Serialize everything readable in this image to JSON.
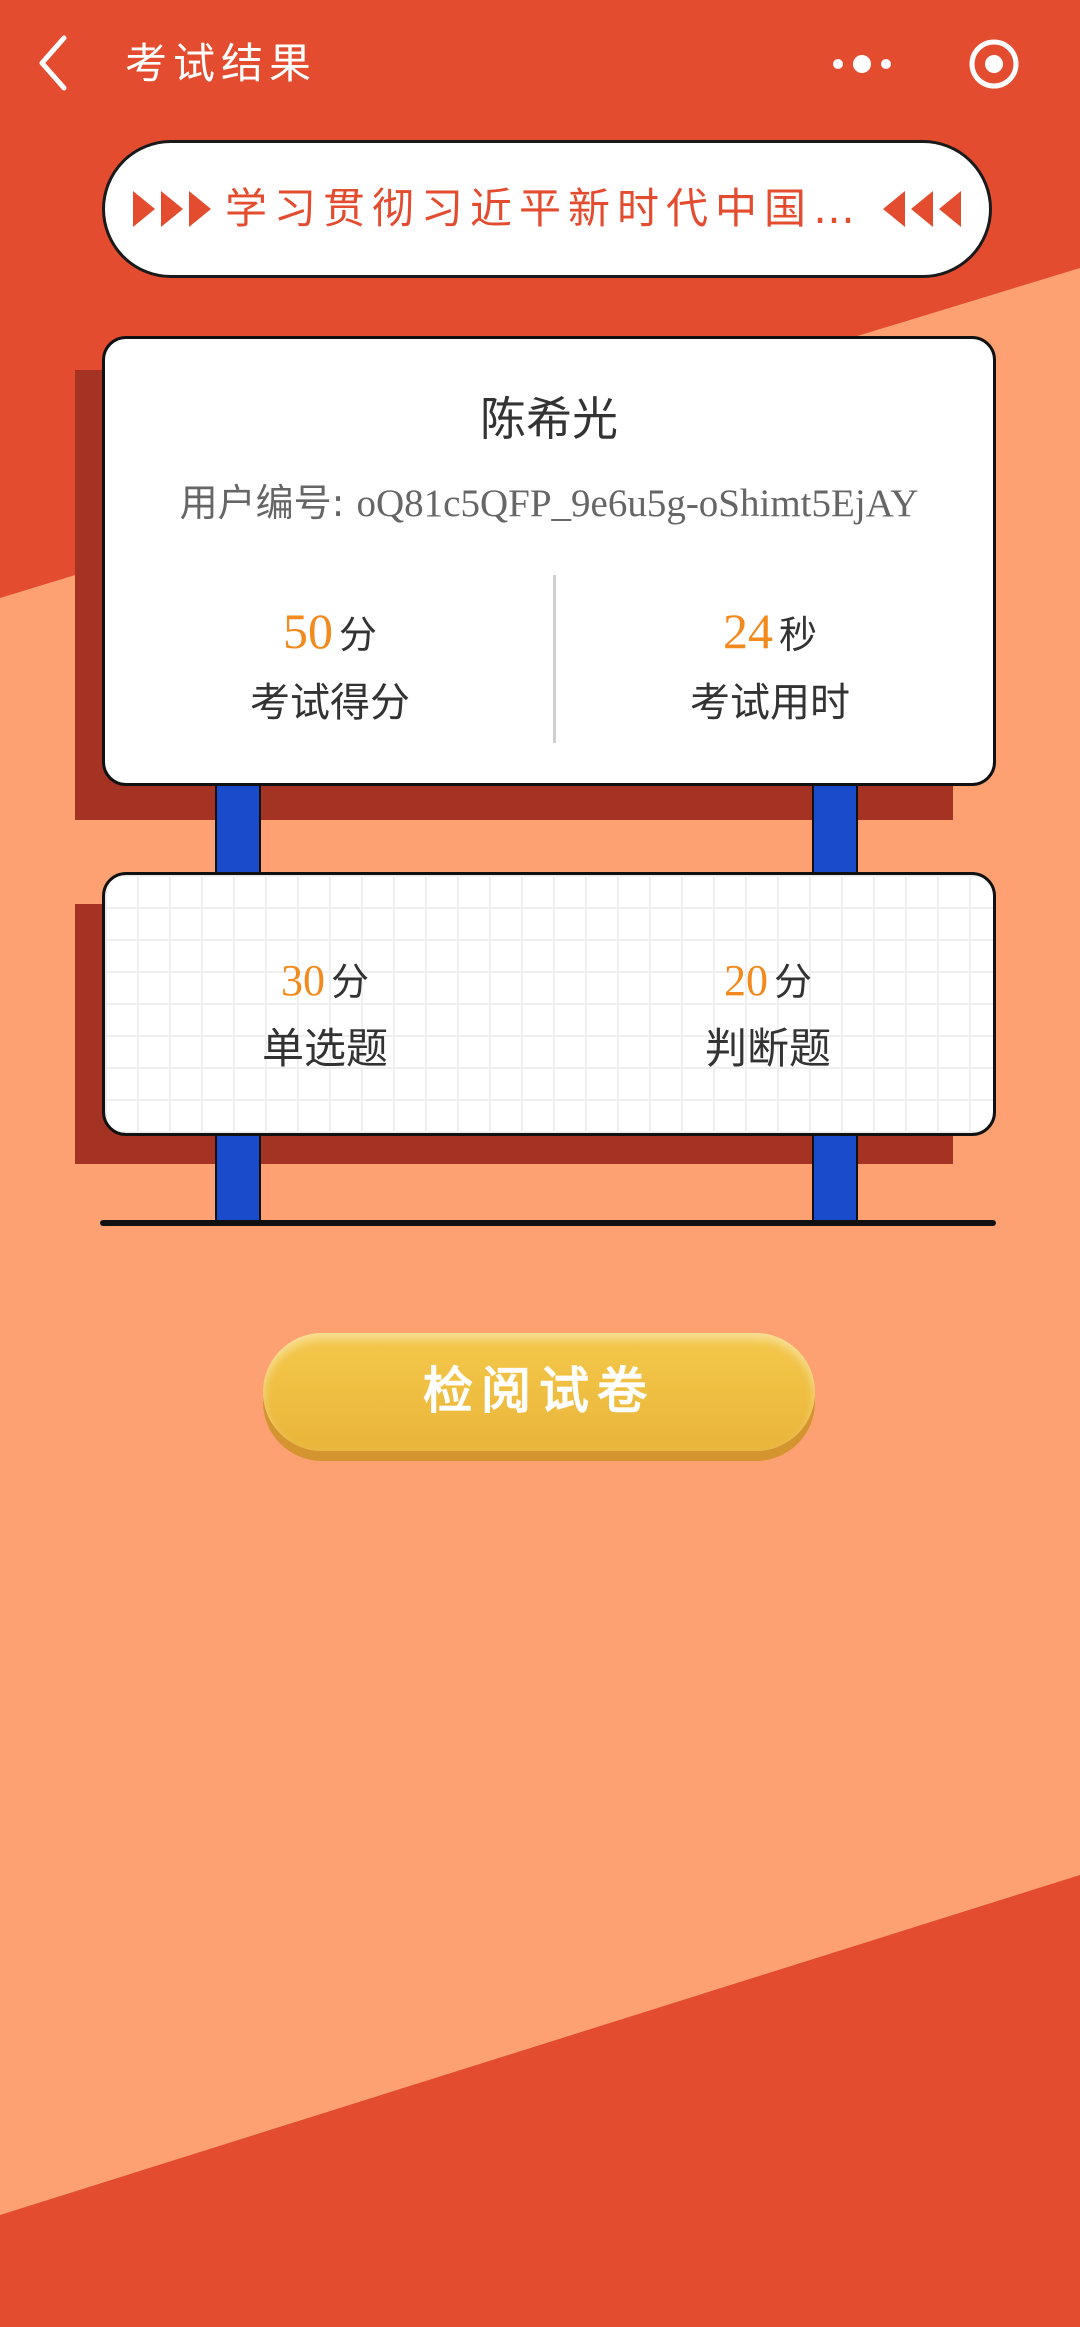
{
  "nav": {
    "title": "考试结果"
  },
  "banner": {
    "text": "学习贯彻习近平新时代中国…"
  },
  "user": {
    "name": "陈希光",
    "id_label": "用户编号: ",
    "id_value": "oQ81c5QFP_9e6u5g-oShimt5EjAY"
  },
  "summary": {
    "score": {
      "value": "50",
      "unit": "分",
      "label": "考试得分"
    },
    "time": {
      "value": "24",
      "unit": "秒",
      "label": "考试用时"
    }
  },
  "breakdown": [
    {
      "value": "30",
      "unit": "分",
      "label": "单选题"
    },
    {
      "value": "20",
      "unit": "分",
      "label": "判断题"
    }
  ],
  "actions": {
    "review_label": "检阅试卷"
  },
  "colors": {
    "primary": "#E34C2F",
    "background": "#FDA072",
    "shadow": "#A43323",
    "post": "#1A4BCB",
    "number": "#F28A1E",
    "button": "#EBB93C"
  }
}
